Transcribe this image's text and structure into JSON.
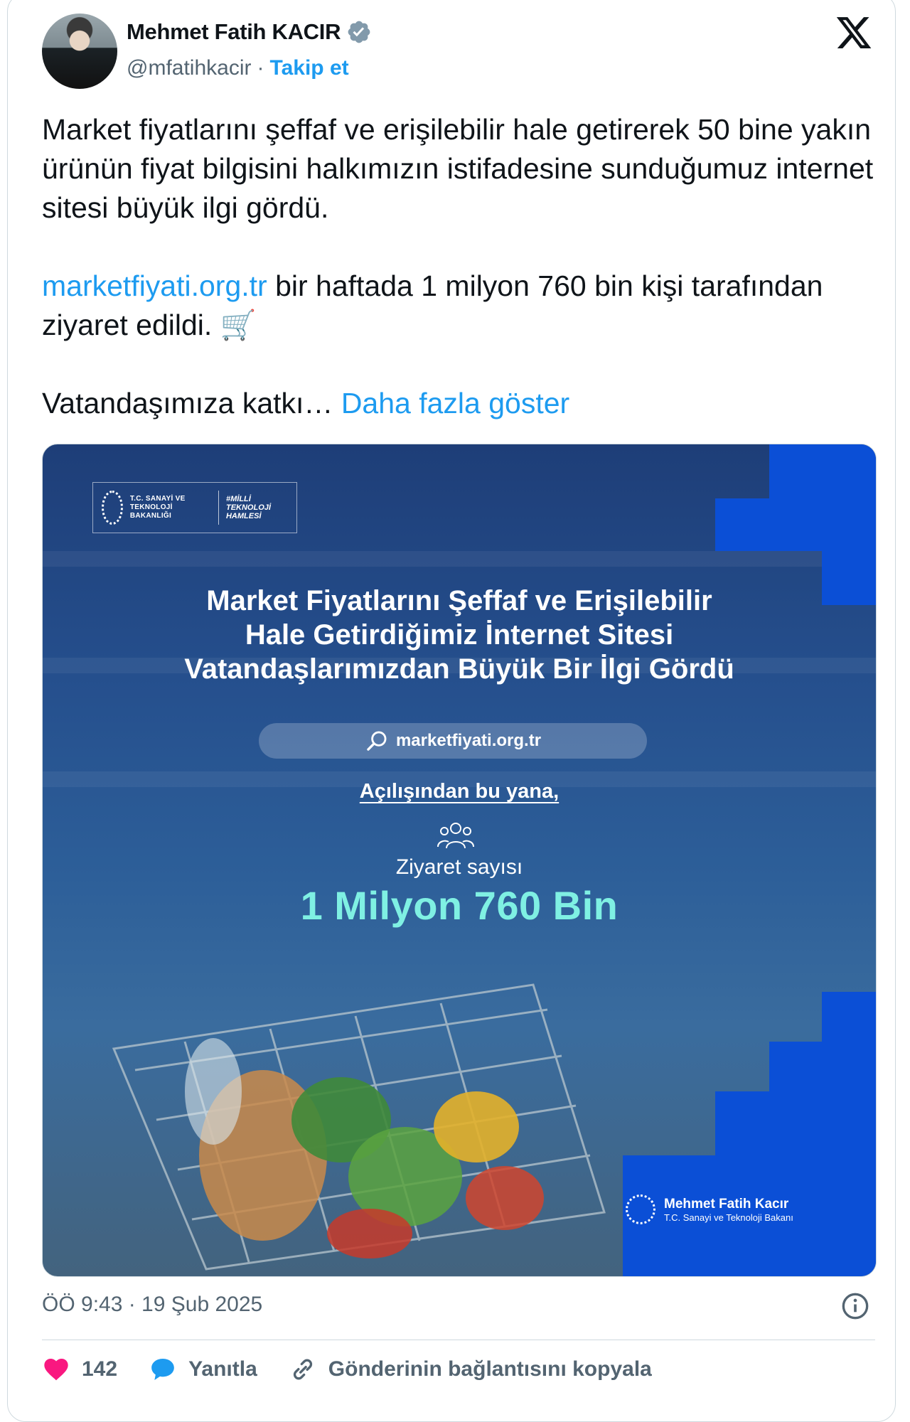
{
  "author": {
    "name": "Mehmet Fatih KACIR",
    "handle": "@mfatihkacir",
    "separator": "·",
    "follow_label": "Takip et"
  },
  "tweet": {
    "paragraph1": "Market fiyatlarını şeffaf ve erişilebilir hale getirerek 50 bine yakın ürünün fiyat bilgisini halkımızın istifadesine sunduğumuz internet sitesi büyük ilgi gördü.",
    "link": "marketfiyati.org.tr",
    "paragraph2_rest": " bir haftada 1 milyon 760 bin kişi tarafından ziyaret edildi. 🛒",
    "paragraph3": "Vatandaşımıza katkı…",
    "show_more": "Daha fazla göster"
  },
  "media": {
    "logo_text": "T.C. SANAYİ VE TEKNOLOJİ BAKANLIĞI",
    "logo_text2": "#MİLLİ TEKNOLOJİ HAMLESİ",
    "headline1": "Market Fiyatlarını Şeffaf ve Erişilebilir",
    "headline2": "Hale Getirdiğimiz İnternet Sitesi",
    "headline3": "Vatandaşlarımızdan Büyük Bir İlgi Gördü",
    "site": "marketfiyati.org.tr",
    "since": "Açılışından bu yana,",
    "visits_label": "Ziyaret sayısı",
    "visits_value": "1 Milyon 760 Bin",
    "signature_name": "Mehmet Fatih Kacır",
    "signature_title": "T.C. Sanayi ve Teknoloji Bakanı"
  },
  "meta": {
    "timestamp": "ÖÖ 9:43 · 19 Şub 2025"
  },
  "actions": {
    "like_count": "142",
    "reply_label": "Yanıtla",
    "copy_label": "Gönderinin bağlantısını kopyala"
  },
  "colors": {
    "accent": "#1d9bf0",
    "like": "#f91880",
    "highlight": "#7ff0e3"
  }
}
